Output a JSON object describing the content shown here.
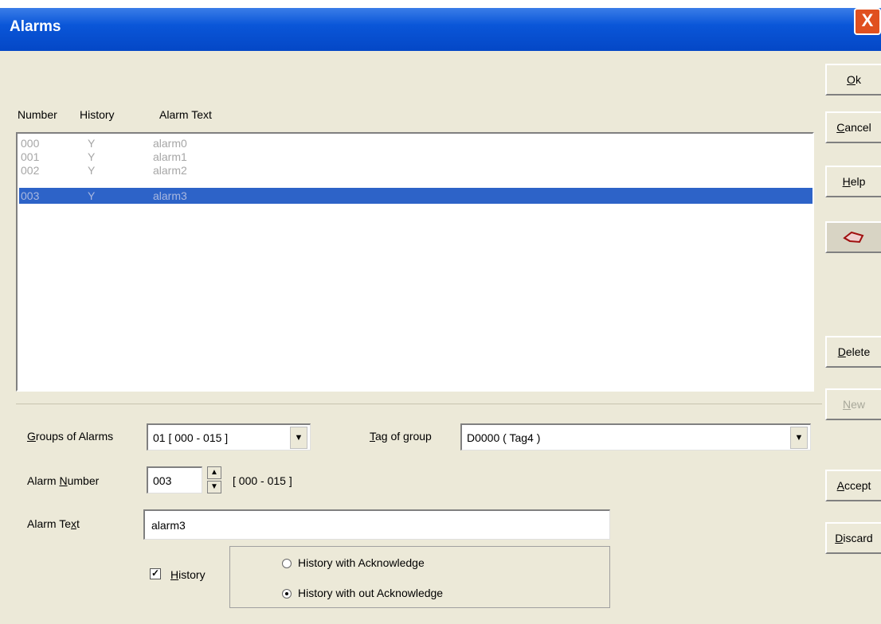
{
  "window": {
    "title": "Alarms",
    "close_glyph": "X"
  },
  "list": {
    "headers": [
      "Number",
      "History",
      "Alarm Text"
    ],
    "rows": [
      {
        "number": "000",
        "history": "Y",
        "text": "alarm0"
      },
      {
        "number": "001",
        "history": "Y",
        "text": "alarm1"
      },
      {
        "number": "002",
        "history": "Y",
        "text": "alarm2"
      },
      {
        "number": "003",
        "history": "Y",
        "text": "alarm3"
      }
    ],
    "selected_index": 3
  },
  "buttons": {
    "ok": {
      "mnemonic": "O",
      "rest": "k"
    },
    "cancel": {
      "mnemonic": "C",
      "rest": "ancel"
    },
    "help": {
      "mnemonic": "H",
      "rest": "elp"
    },
    "delete": {
      "mnemonic": "D",
      "rest": "elete"
    },
    "new": {
      "mnemonic": "N",
      "rest": "ew",
      "enabled": false
    },
    "accept": {
      "mnemonic": "A",
      "rest": "ccept"
    },
    "discard": {
      "mnemonic": "D",
      "rest": "iscard"
    },
    "pin_icon": "pin-icon"
  },
  "form": {
    "groups_label": {
      "mnemonic": "G",
      "rest": "roups of Alarms"
    },
    "groups_value": "01  [ 000 - 015 ]",
    "tag_label": {
      "mnemonic": "T",
      "rest": "ag of group"
    },
    "tag_value": "D0000 ( Tag4 )",
    "alarm_number_label": {
      "pre": "Alarm ",
      "mnemonic": "N",
      "rest": "umber"
    },
    "alarm_number_value": "003",
    "alarm_number_range": "[ 000 - 015 ]",
    "alarm_text_label": {
      "pre": "Alarm Te",
      "mnemonic": "x",
      "rest": "t"
    },
    "alarm_text_value": "alarm3",
    "history_label": {
      "mnemonic": "H",
      "rest": "istory"
    },
    "history_checked": true,
    "radio_with_ack": "History with Acknowledge",
    "radio_without_ack": "History with out Acknowledge",
    "radio_selected": "without"
  }
}
